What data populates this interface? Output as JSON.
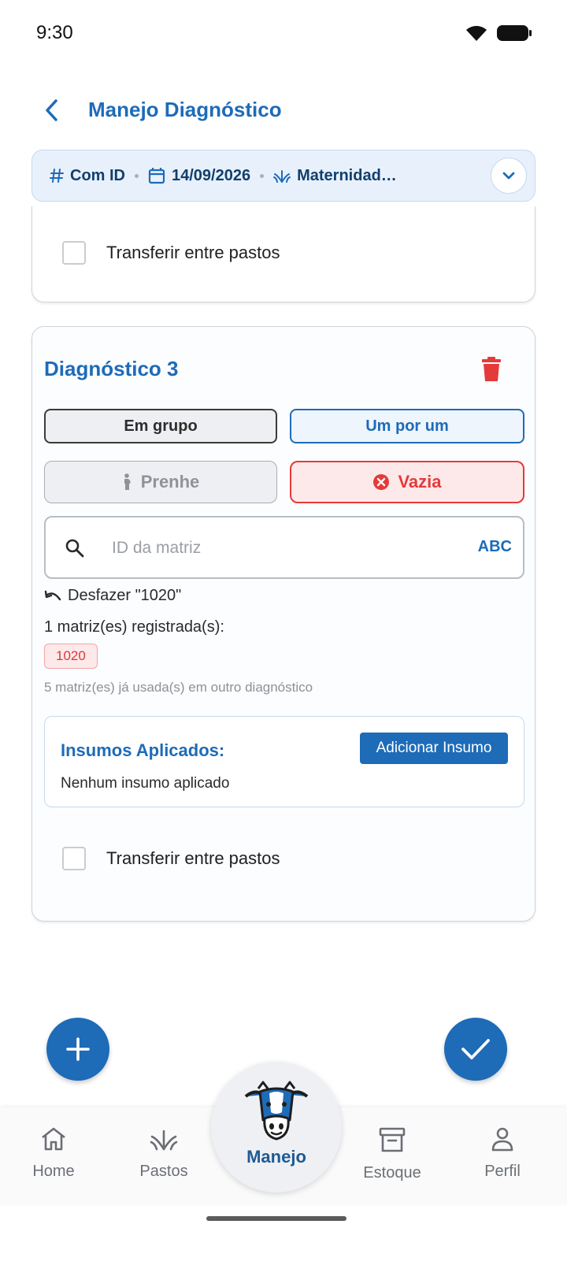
{
  "status_bar": {
    "time": "9:30",
    "icons": [
      "wifi-icon",
      "battery-icon"
    ]
  },
  "header": {
    "title": "Manejo Diagnóstico",
    "back_icon": "chevron-left-icon"
  },
  "summary": {
    "id_mode": "Com ID",
    "date": "14/09/2026",
    "location": "Maternidad…",
    "icons": [
      "hash-icon",
      "calendar-icon",
      "grass-icon",
      "chevron-down-icon"
    ]
  },
  "previous_card": {
    "transfer_label": "Transferir entre pastos"
  },
  "card": {
    "title": "Diagnóstico 3",
    "mode_group": "Em grupo",
    "mode_single": "Um por um",
    "status_pregnant": "Prenhe",
    "status_empty": "Vazia",
    "search_placeholder": "ID da matriz",
    "search_value": "",
    "abc_label": "ABC",
    "undo_label": "Desfazer \"1020\"",
    "registered_label": "1 matriz(es) registrada(s):",
    "registered_ids": [
      "1020"
    ],
    "used_note": "5 matriz(es) já usada(s) em outro diagnóstico",
    "insumos": {
      "title": "Insumos Aplicados:",
      "add_label": "Adicionar Insumo",
      "empty_label": "Nenhum insumo aplicado"
    },
    "transfer_label": "Transferir entre pastos"
  },
  "bottom_nav": {
    "home": "Home",
    "pastos": "Pastos",
    "manejo": "Manejo",
    "estoque": "Estoque",
    "perfil": "Perfil"
  },
  "colors": {
    "primary": "#1e6bb8",
    "danger": "#e53a3a",
    "summary_bg": "#e8f1fb"
  }
}
